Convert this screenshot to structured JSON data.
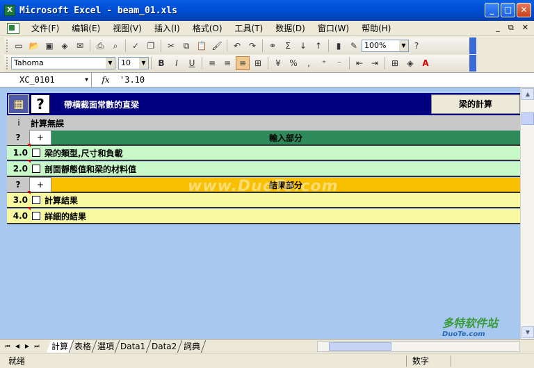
{
  "window": {
    "title": "Microsoft Excel - beam_01.xls",
    "app_icon": "X",
    "minimize": "_",
    "maximize": "□",
    "close": "✕"
  },
  "menu": {
    "items": [
      "文件(F)",
      "编辑(E)",
      "视图(V)",
      "插入(I)",
      "格式(O)",
      "工具(T)",
      "数据(D)",
      "窗口(W)",
      "帮助(H)"
    ],
    "right": [
      "_",
      "⧉",
      "✕"
    ]
  },
  "toolbar": {
    "zoom": "100%",
    "font_name": "Tahoma",
    "font_size": "10"
  },
  "formula": {
    "cell_ref": "XC_0101",
    "fx": "fx",
    "value": "'3.10"
  },
  "sheet": {
    "header_title": "帶横截面常數的直梁",
    "header_button": "梁的計算",
    "info_label": "i",
    "info_text": "計算無誤",
    "input_q": "?",
    "input_plus": "+",
    "input_title": "輸入部分",
    "result_q": "?",
    "result_plus": "+",
    "result_title": "結果部分",
    "rows": [
      {
        "num": "1.0",
        "label": "梁的類型,尺寸和負載"
      },
      {
        "num": "2.0",
        "label": "剖面靜態值和梁的材料值"
      },
      {
        "num": "3.0",
        "label": "計算結果"
      },
      {
        "num": "4.0",
        "label": "詳細的結果"
      }
    ],
    "watermark": "www.DuoTe.com",
    "logo_text": "多特软件站",
    "logo_sub": "DuoTe.com"
  },
  "tabs": [
    "計算",
    "表格",
    "選項",
    "Data1",
    "Data2",
    "詞典"
  ],
  "status": {
    "ready": "就绪",
    "mode": "数字"
  }
}
